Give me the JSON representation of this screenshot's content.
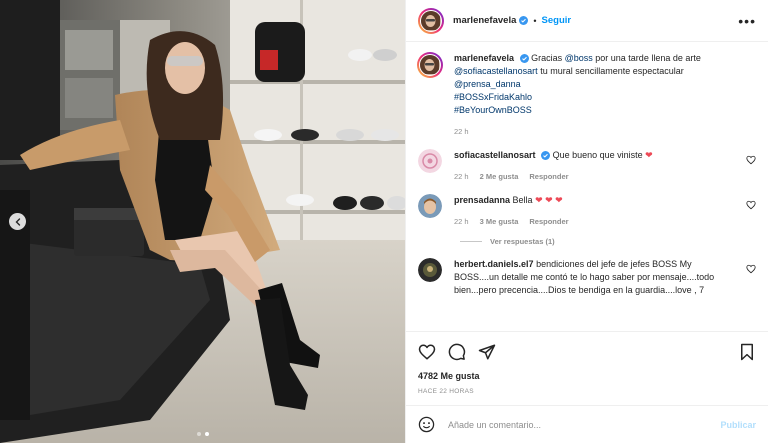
{
  "post": {
    "author": "marlenefavela",
    "separator": "•",
    "follow_label": "Seguir",
    "more_label": "•••"
  },
  "caption": {
    "author": "marlenefavela",
    "parts": [
      "Gracias",
      "@boss",
      "por una tarde llena de arte",
      "@sofiacastellanosart",
      "tu mural sencillamente espectacular",
      "@prensa_danna",
      "#BOSSxFridaKahlo",
      "#BeYourOwnBOSS"
    ],
    "time": "22 h"
  },
  "comments": [
    {
      "user": "sofiacastellanosart",
      "verified": true,
      "text": "Que bueno que viniste",
      "emoji": "❤",
      "time": "22 h",
      "likes": "2 Me gusta",
      "reply": "Responder"
    },
    {
      "user": "prensadanna",
      "verified": false,
      "text": "Bella",
      "emoji": "❤ ❤ ❤",
      "time": "22 h",
      "likes": "3 Me gusta",
      "reply": "Responder",
      "view_replies": "Ver respuestas (1)"
    },
    {
      "user": "herbert.daniels.el7",
      "verified": false,
      "text": "bendiciones del jefe de jefes BOSS My BOSS....un detalle me contó te lo hago saber por mensaje....todo bien...pero precencia....Dios te bendiga en la guardia....love , 7"
    }
  ],
  "actions": {
    "likes": "4782 Me gusta",
    "timestamp": "HACE 22 HORAS"
  },
  "composer": {
    "placeholder": "Añade un comentario...",
    "publish_label": "Publicar"
  },
  "colors": {
    "accent": "#0095f6",
    "heart": "#ed4956",
    "link": "#00376b",
    "muted": "#8e8e8e"
  },
  "icons": [
    "heart-icon",
    "comment-icon",
    "share-icon",
    "save-icon",
    "emoji-icon",
    "verified-icon",
    "chevron-left-icon"
  ]
}
